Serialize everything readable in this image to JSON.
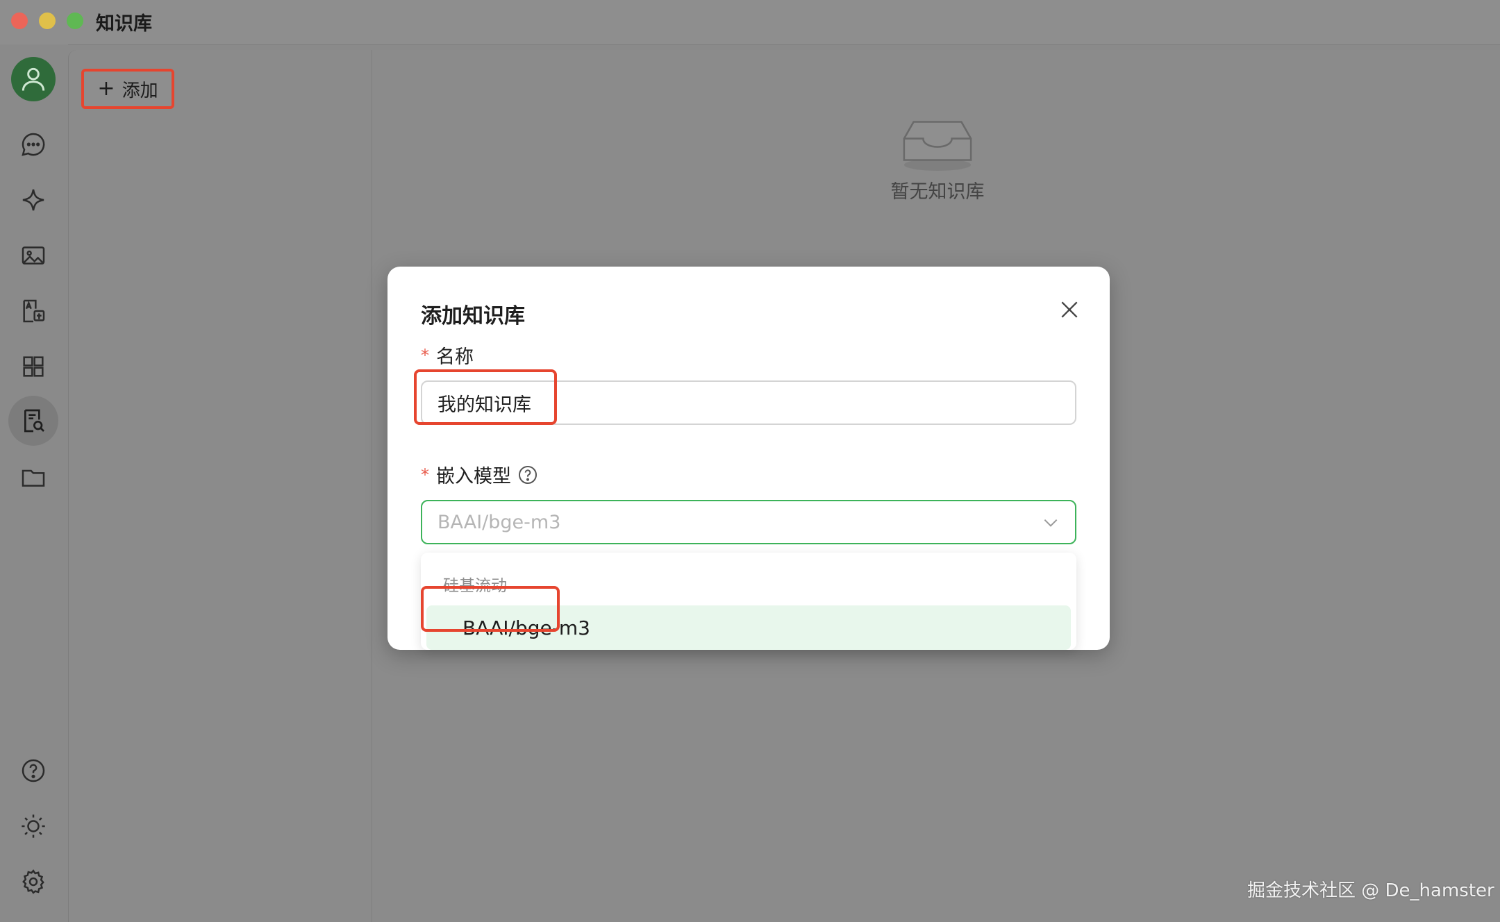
{
  "window": {
    "title": "知识库"
  },
  "sidebar": {
    "items": [
      {
        "name": "avatar",
        "icon": "user-icon"
      },
      {
        "name": "chat",
        "icon": "chat-bubble-icon"
      },
      {
        "name": "agents",
        "icon": "sparkle-icon"
      },
      {
        "name": "images",
        "icon": "image-icon"
      },
      {
        "name": "translate",
        "icon": "translate-icon"
      },
      {
        "name": "apps",
        "icon": "grid-icon"
      },
      {
        "name": "knowledge",
        "icon": "knowledge-search-icon",
        "active": true
      },
      {
        "name": "files",
        "icon": "folder-icon"
      },
      {
        "name": "help",
        "icon": "help-circle-icon"
      },
      {
        "name": "theme",
        "icon": "sun-icon"
      },
      {
        "name": "settings",
        "icon": "gear-icon"
      }
    ]
  },
  "toolbar": {
    "add_label": "添加"
  },
  "empty_state": {
    "text": "暂无知识库"
  },
  "modal": {
    "title": "添加知识库",
    "name_label": "名称",
    "name_value": "我的知识库",
    "embed_label": "嵌入模型",
    "embed_placeholder": "BAAI/bge-m3",
    "dropdown": {
      "group": "硅基流动",
      "options": [
        "BAAI/bge-m3"
      ]
    }
  },
  "watermark": "掘金技术社区 @ De_hamster",
  "colors": {
    "accent_green": "#3db35a",
    "highlight_red": "#e6452f",
    "option_bg": "#e8f7ec"
  }
}
